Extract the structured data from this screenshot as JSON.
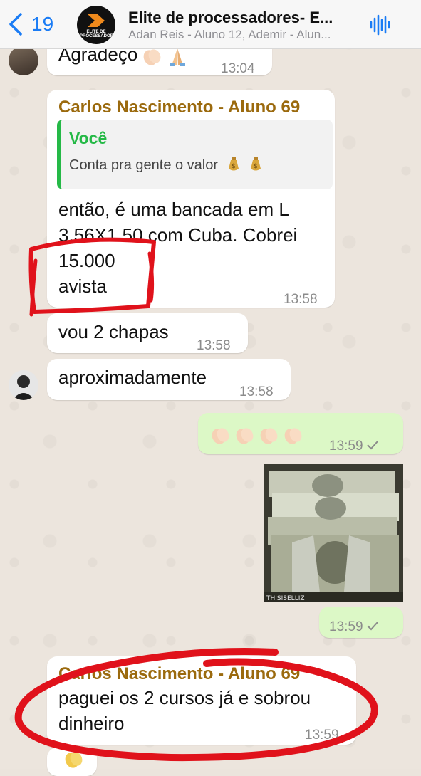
{
  "header": {
    "back_count": "19",
    "title": "Elite de processadores- E...",
    "subtitle": "Adan Reis - Aluno 12, Ademir - Alun...",
    "logo_text": "ELITE DE PROCESSADORES"
  },
  "messages": {
    "m1": {
      "text": "Agradeço",
      "time": "13:04"
    },
    "m2": {
      "sender": "Carlos Nascimento - Aluno 69",
      "quote_name": "Você",
      "quote_text": "Conta pra gente o valor",
      "line1": "então, é uma bancada em L",
      "line2": "3.56X1.50 com Cuba. Cobrei",
      "line3": "15.000",
      "line4": "avista",
      "time": "13:58"
    },
    "m3": {
      "text": "vou 2 chapas",
      "time": "13:58"
    },
    "m4": {
      "text": "aproximadamente",
      "time": "13:58"
    },
    "m5": {
      "time": "13:59"
    },
    "m6": {
      "image_caption": "THISISELLIZ",
      "time": "13:59"
    },
    "m7": {
      "sender": "Carlos Nascimento - Aluno 69",
      "line1": "paguei os 2 cursos já e sobrou",
      "line2": "dinheiro",
      "time": "13:59"
    }
  },
  "colors": {
    "accent": "#1a7cf5",
    "sender": "#9b6a0e",
    "quote_green": "#25b947",
    "outgoing": "#dcf8c6",
    "annotation_red": "#e0121b"
  }
}
